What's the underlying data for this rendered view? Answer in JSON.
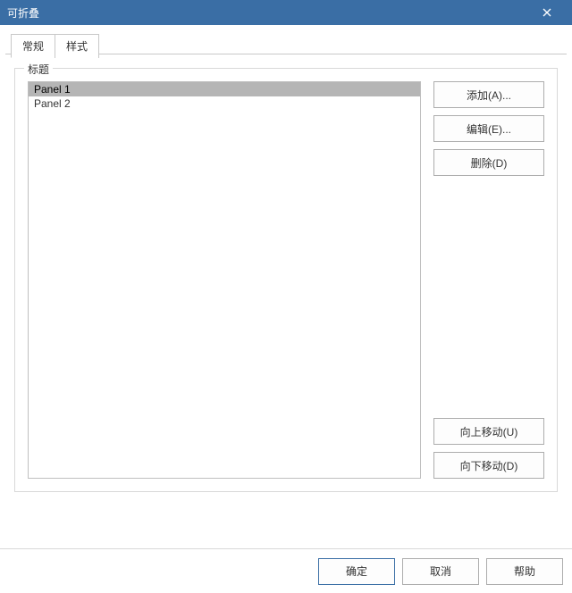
{
  "window": {
    "title": "可折叠",
    "close_icon": "close-icon"
  },
  "tabs": [
    {
      "label": "常规",
      "active": true
    },
    {
      "label": "样式",
      "active": false
    }
  ],
  "groupbox": {
    "legend": "标题"
  },
  "list": {
    "items": [
      {
        "label": "Panel 1",
        "selected": true
      },
      {
        "label": "Panel 2",
        "selected": false
      }
    ]
  },
  "buttons": {
    "add": "添加(A)...",
    "edit": "编辑(E)...",
    "delete": "删除(D)",
    "move_up": "向上移动(U)",
    "move_down": "向下移动(D)"
  },
  "footer": {
    "ok": "确定",
    "cancel": "取消",
    "help": "帮助"
  }
}
